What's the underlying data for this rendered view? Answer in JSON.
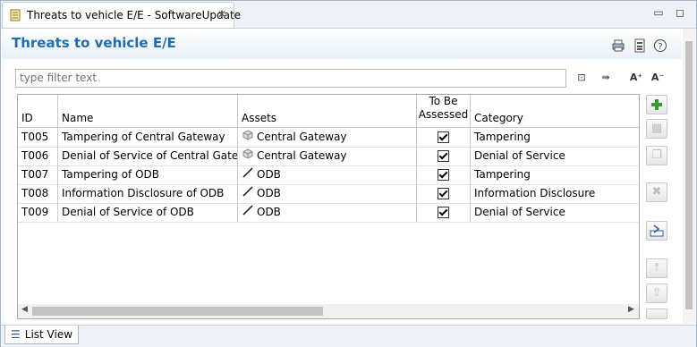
{
  "editor_tab": {
    "title": "Threats to vehicle E/E - SoftwareUpdate"
  },
  "header": {
    "title": "Threats to vehicle E/E"
  },
  "filter": {
    "placeholder": "type filter text"
  },
  "table": {
    "columns": {
      "id": "ID",
      "name": "Name",
      "assets": "Assets",
      "to_be_line1": "To Be",
      "to_be_line2": "Assessed",
      "category": "Category"
    },
    "rows": [
      {
        "id": "T005",
        "name": "Tampering of Central Gateway",
        "asset_icon": "component-icon",
        "asset": "Central Gateway",
        "assessed": true,
        "category": "Tampering"
      },
      {
        "id": "T006",
        "name": "Denial of Service of Central Gateway",
        "asset_icon": "component-icon",
        "asset": "Central Gateway",
        "assessed": true,
        "category": "Denial of Service"
      },
      {
        "id": "T007",
        "name": "Tampering of ODB",
        "asset_icon": "connection-icon",
        "asset": "ODB",
        "assessed": true,
        "category": "Tampering"
      },
      {
        "id": "T008",
        "name": "Information Disclosure of ODB",
        "asset_icon": "connection-icon",
        "asset": "ODB",
        "assessed": true,
        "category": "Information Disclosure"
      },
      {
        "id": "T009",
        "name": "Denial of Service of ODB",
        "asset_icon": "connection-icon",
        "asset": "ODB",
        "assessed": true,
        "category": "Denial of Service"
      }
    ]
  },
  "side_buttons": [
    "add-icon",
    "table-icon",
    "copy-icon",
    "delete-icon",
    "import-icon",
    "move-top-icon",
    "move-up-icon"
  ],
  "bottom_tab": {
    "label": "List View"
  },
  "colors": {
    "title_blue": "#1e6db4",
    "add_green": "#3a9a2f"
  }
}
